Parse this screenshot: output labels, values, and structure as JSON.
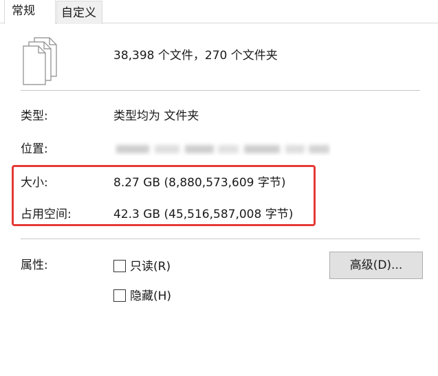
{
  "tabs": {
    "general": "常规",
    "custom": "自定义"
  },
  "summary": {
    "contents": "38,398 个文件，270 个文件夹"
  },
  "properties": {
    "type_label": "类型:",
    "type_value": "类型均为 文件夹",
    "location_label": "位置:",
    "size_label": "大小:",
    "size_value": "8.27 GB (8,880,573,609 字节)",
    "disk_label": "占用空间:",
    "disk_value": "42.3 GB (45,516,587,008 字节)"
  },
  "attributes": {
    "label": "属性:",
    "readonly": "只读(R)",
    "hidden": "隐藏(H)",
    "advanced_button": "高级(D)..."
  },
  "colors": {
    "highlight": "#e53935",
    "button_bg": "#e1e1e1"
  }
}
